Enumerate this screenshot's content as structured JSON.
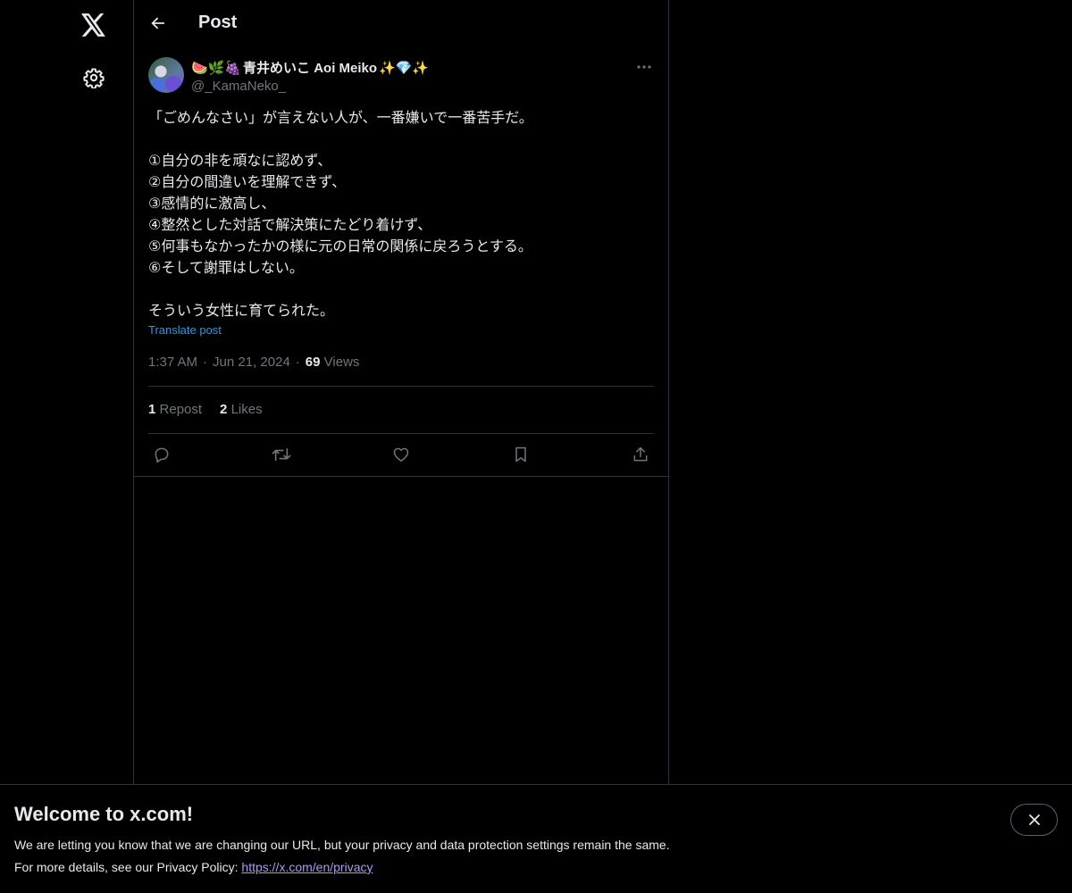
{
  "header": {
    "title": "Post"
  },
  "post": {
    "display_name": "青井めいこ Aoi Meiko",
    "name_prefix_emojis": "🍉🌿🍇",
    "name_suffix_emojis": "✨💎✨",
    "handle": "@_KamaNeko_",
    "body": "「ごめんなさい」が言えない人が、一番嫌いで一番苦手だ。\n\n①自分の非を頑なに認めず、\n②自分の間違いを理解できず、\n③感情的に激高し、\n④整然とした対話で解決策にたどり着けず、\n⑤何事もなかったかの様に元の日常の関係に戻ろうとする。\n⑥そして謝罪はしない。\n\nそういう女性に育てられた。",
    "translate_label": "Translate post",
    "time": "1:37 AM",
    "date": "Jun 21, 2024",
    "views_count": "69",
    "views_label": "Views",
    "reposts_count": "1",
    "reposts_label": "Repost",
    "likes_count": "2",
    "likes_label": "Likes"
  },
  "icons": {
    "logo": "x-logo-icon",
    "settings": "gear-icon",
    "back": "arrow-left-icon",
    "more": "more-horizontal-icon",
    "reply": "reply-icon",
    "repost": "repost-icon",
    "like": "heart-icon",
    "bookmark": "bookmark-icon",
    "share": "share-icon",
    "close": "close-icon"
  },
  "banner": {
    "title": "Welcome to x.com!",
    "line1": "We are letting you know that we are changing our URL, but your privacy and data protection settings remain the same.",
    "line2_prefix": "For more details, see our Privacy Policy: ",
    "link": "https://x.com/en/privacy"
  },
  "colors": {
    "background": "#000000",
    "text": "#e7e9ea",
    "muted": "#71767b",
    "accent": "#1d9bf0",
    "border": "#2f3336",
    "link": "#a99cf5"
  }
}
